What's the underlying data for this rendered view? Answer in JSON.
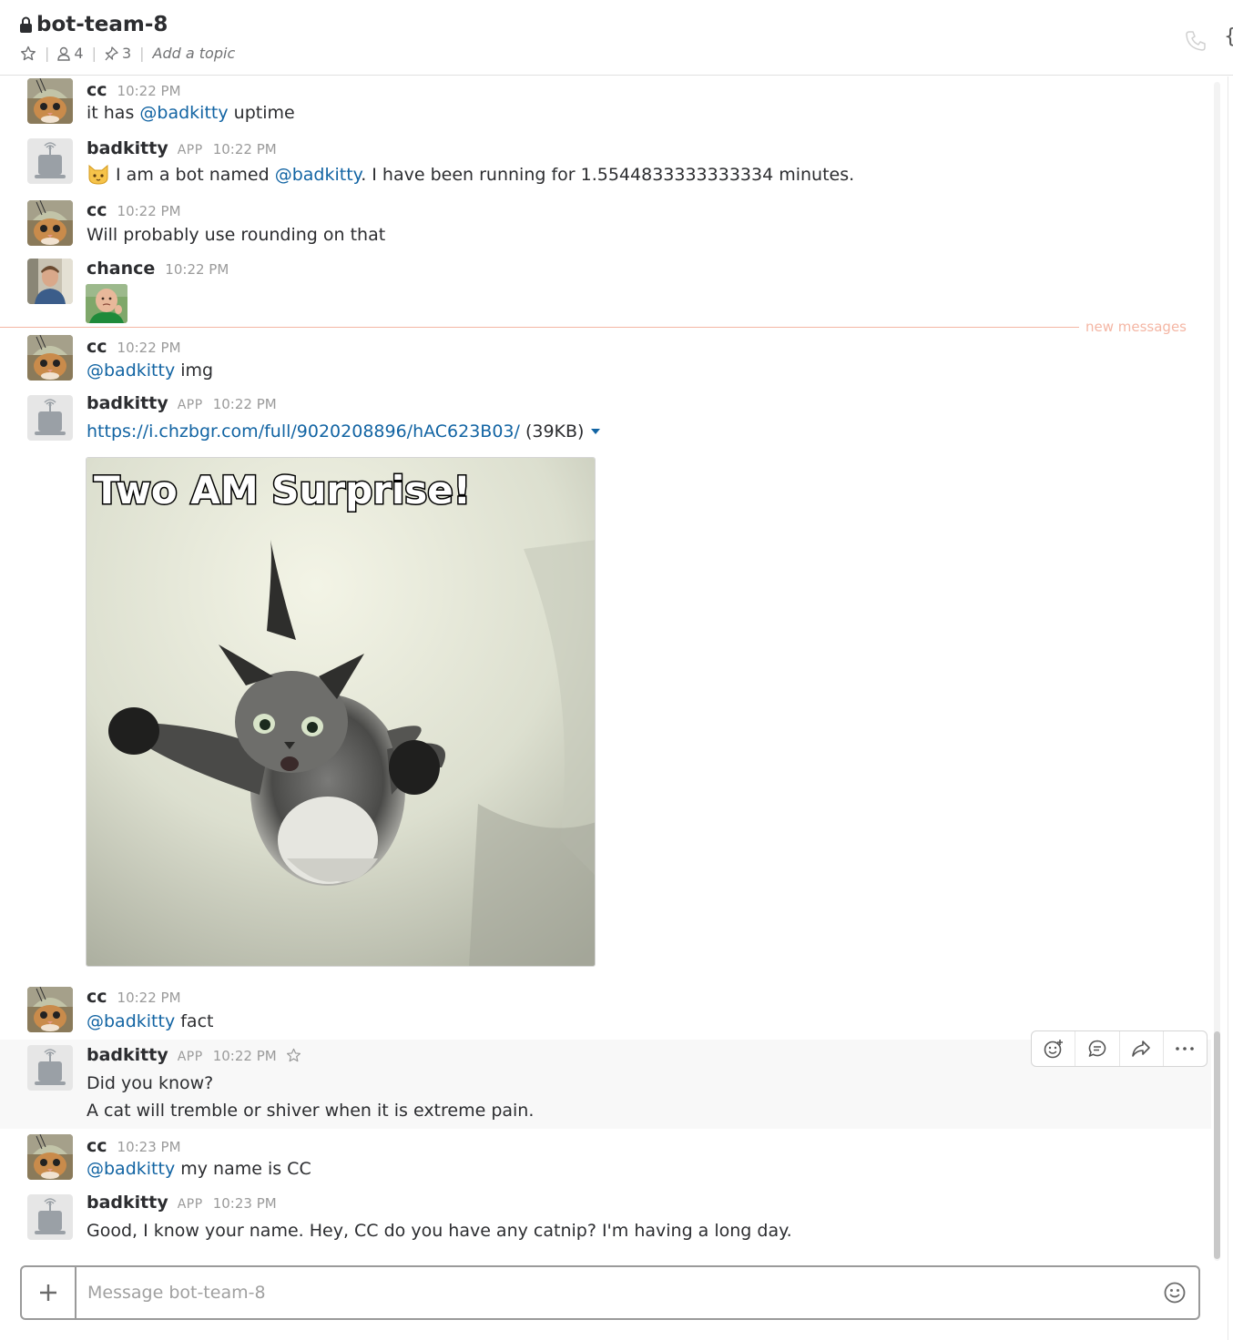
{
  "channel": {
    "name": "bot-team-8",
    "members_count": "4",
    "pinned_count": "3",
    "topic_placeholder": "Add a topic"
  },
  "new_messages_label": "new messages",
  "messages": [
    {
      "sender": "cc",
      "time": "10:22 PM",
      "parts": [
        {
          "text": "it has "
        },
        {
          "mention": "@badkitty"
        },
        {
          "text": " uptime"
        }
      ]
    },
    {
      "sender": "badkitty",
      "app": "APP",
      "time": "10:22 PM",
      "parts": [
        {
          "text": " I am a bot named "
        },
        {
          "mention": "@badkitty"
        },
        {
          "text": ". I have been running for 1.5544833333333334 minutes."
        }
      ]
    },
    {
      "sender": "cc",
      "time": "10:22 PM",
      "text": "Will probably use rounding on that"
    },
    {
      "sender": "chance",
      "time": "10:22 PM"
    },
    {
      "sender": "cc",
      "time": "10:22 PM",
      "parts": [
        {
          "mention": "@badkitty"
        },
        {
          "text": " img"
        }
      ]
    },
    {
      "sender": "badkitty",
      "app": "APP",
      "time": "10:22 PM",
      "link": "https://i.chzbgr.com/full/9020208896/hAC623B03/",
      "size": "(39KB)",
      "image_caption": "Two AM Surprise!"
    },
    {
      "sender": "cc",
      "time": "10:22 PM",
      "parts": [
        {
          "mention": "@badkitty"
        },
        {
          "text": " fact"
        }
      ]
    },
    {
      "sender": "badkitty",
      "app": "APP",
      "time": "10:22 PM",
      "line1": "Did you know?",
      "line2": "A cat will tremble or shiver when it is extreme pain."
    },
    {
      "sender": "cc",
      "time": "10:23 PM",
      "parts": [
        {
          "mention": "@badkitty"
        },
        {
          "text": " my name is CC"
        }
      ]
    },
    {
      "sender": "badkitty",
      "app": "APP",
      "time": "10:23 PM",
      "text": "Good, I know your name. Hey, CC do you have any catnip? I'm having a long day."
    }
  ],
  "composer": {
    "placeholder": "Message bot-team-8"
  },
  "colors": {
    "mention": "#1264a3",
    "new_divider": "#f4b6a4"
  }
}
